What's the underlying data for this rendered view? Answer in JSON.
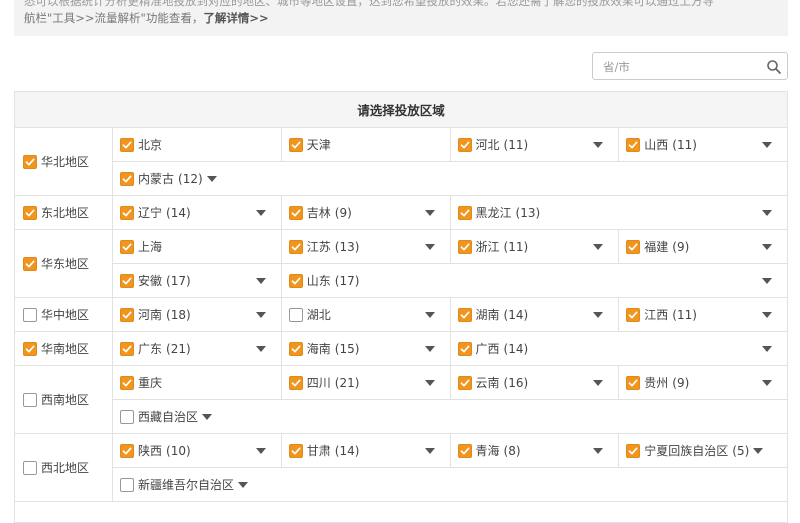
{
  "notice": {
    "line1": "悉可以根据统计分析更精准地投放到对应的地区、城市等地区设置，达到您希望投放的效果。若您还需了解您的投放效果可以通过上方导",
    "line2_prefix": "航栏\"工具>>流量解析\"功能查看，",
    "more_link": "了解详情>>"
  },
  "search": {
    "placeholder": "省/市"
  },
  "table": {
    "title": "请选择投放区域",
    "groups": [
      {
        "name": "华北地区",
        "checked": true,
        "rows": [
          [
            {
              "name": "北京",
              "count": "",
              "checked": true,
              "caret": false
            },
            {
              "name": "天津",
              "count": "",
              "checked": true,
              "caret": false
            },
            {
              "name": "河北",
              "count": "(11)",
              "checked": true,
              "caret": true
            },
            {
              "name": "山西",
              "count": "(11)",
              "checked": true,
              "caret": true
            }
          ],
          [
            {
              "name": "内蒙古",
              "count": "(12)",
              "checked": true,
              "caret": true,
              "tight": true
            }
          ]
        ]
      },
      {
        "name": "东北地区",
        "checked": true,
        "rows": [
          [
            {
              "name": "辽宁",
              "count": "(14)",
              "checked": true,
              "caret": true
            },
            {
              "name": "吉林",
              "count": "(9)",
              "checked": true,
              "caret": true
            },
            {
              "name": "黑龙江",
              "count": "(13)",
              "checked": true,
              "caret": true
            }
          ]
        ]
      },
      {
        "name": "华东地区",
        "checked": true,
        "rows": [
          [
            {
              "name": "上海",
              "count": "",
              "checked": true,
              "caret": false
            },
            {
              "name": "江苏",
              "count": "(13)",
              "checked": true,
              "caret": true
            },
            {
              "name": "浙江",
              "count": "(11)",
              "checked": true,
              "caret": true
            },
            {
              "name": "福建",
              "count": "(9)",
              "checked": true,
              "caret": true
            }
          ],
          [
            {
              "name": "安徽",
              "count": "(17)",
              "checked": true,
              "caret": true
            },
            {
              "name": "山东",
              "count": "(17)",
              "checked": true,
              "caret": true
            }
          ]
        ]
      },
      {
        "name": "华中地区",
        "checked": false,
        "rows": [
          [
            {
              "name": "河南",
              "count": "(18)",
              "checked": true,
              "caret": true
            },
            {
              "name": "湖北",
              "count": "",
              "checked": false,
              "caret": true
            },
            {
              "name": "湖南",
              "count": "(14)",
              "checked": true,
              "caret": true
            },
            {
              "name": "江西",
              "count": "(11)",
              "checked": true,
              "caret": true
            }
          ]
        ]
      },
      {
        "name": "华南地区",
        "checked": true,
        "rows": [
          [
            {
              "name": "广东",
              "count": "(21)",
              "checked": true,
              "caret": true
            },
            {
              "name": "海南",
              "count": "(15)",
              "checked": true,
              "caret": true
            },
            {
              "name": "广西",
              "count": "(14)",
              "checked": true,
              "caret": true
            }
          ]
        ]
      },
      {
        "name": "西南地区",
        "checked": false,
        "rows": [
          [
            {
              "name": "重庆",
              "count": "",
              "checked": true,
              "caret": false
            },
            {
              "name": "四川",
              "count": "(21)",
              "checked": true,
              "caret": true
            },
            {
              "name": "云南",
              "count": "(16)",
              "checked": true,
              "caret": true
            },
            {
              "name": "贵州",
              "count": "(9)",
              "checked": true,
              "caret": true
            }
          ],
          [
            {
              "name": "西藏自治区",
              "count": "",
              "checked": false,
              "caret": true,
              "tight": true
            }
          ]
        ]
      },
      {
        "name": "西北地区",
        "checked": false,
        "rows": [
          [
            {
              "name": "陕西",
              "count": "(10)",
              "checked": true,
              "caret": true
            },
            {
              "name": "甘肃",
              "count": "(14)",
              "checked": true,
              "caret": true
            },
            {
              "name": "青海",
              "count": "(8)",
              "checked": true,
              "caret": true
            },
            {
              "name": "宁夏回族自治区",
              "count": "(5)",
              "checked": true,
              "caret": true,
              "tight": true
            }
          ],
          [
            {
              "name": "新疆维吾尔自治区",
              "count": "",
              "checked": false,
              "caret": true,
              "tight": true
            }
          ]
        ]
      },
      {
        "name": "",
        "checked": false,
        "hidden": true,
        "rows": []
      }
    ]
  },
  "colors": {
    "checkbox_on": "#f0951e",
    "header_bg": "#f5f5f5",
    "notice_bg": "#f3f3f3"
  }
}
